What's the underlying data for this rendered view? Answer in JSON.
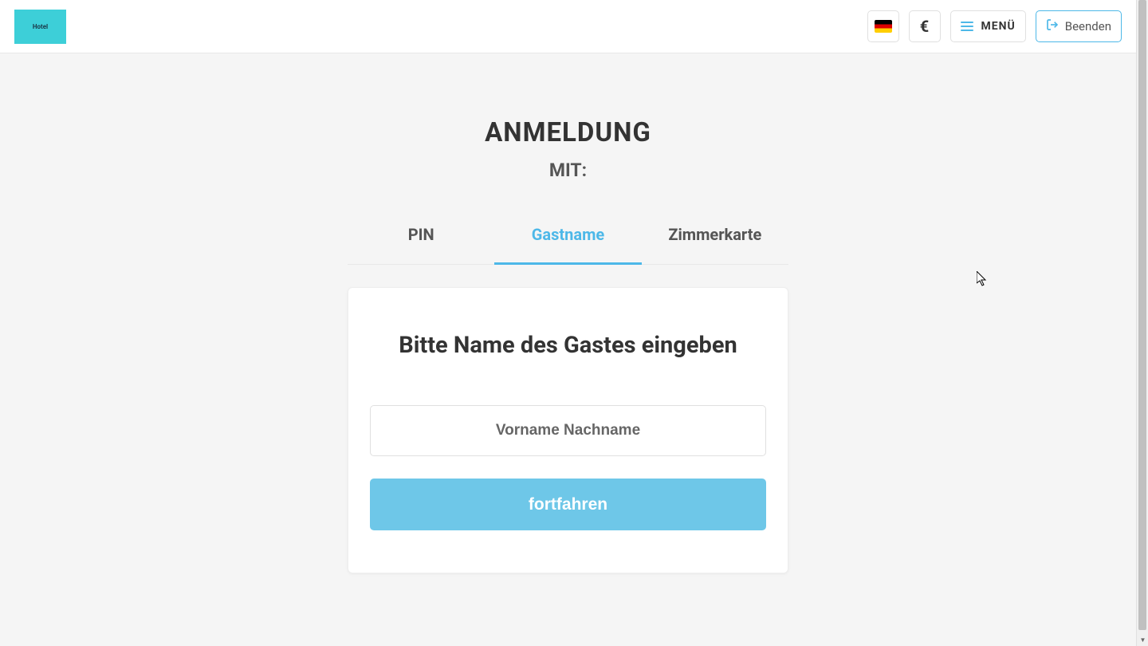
{
  "header": {
    "logo_text": "Hotel",
    "currency_symbol": "€",
    "menu_label": "MENÜ",
    "exit_label": "Beenden"
  },
  "main": {
    "title": "ANMELDUNG",
    "subtitle": "MIT:",
    "tabs": [
      {
        "label": "PIN",
        "active": false
      },
      {
        "label": "Gastname",
        "active": true
      },
      {
        "label": "Zimmerkarte",
        "active": false
      }
    ],
    "card": {
      "title": "Bitte Name des Gastes eingeben",
      "input_placeholder": "Vorname Nachname",
      "input_value": "",
      "continue_label": "fortfahren"
    }
  },
  "colors": {
    "accent": "#4db8e8",
    "button_bg": "#6ec7e8"
  }
}
